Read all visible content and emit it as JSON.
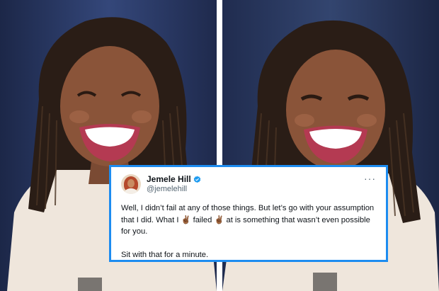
{
  "tweet": {
    "display_name": "Jemele Hill",
    "handle": "@jemelehill",
    "verified_icon": "verified-badge-icon",
    "more_icon": "more-options-icon",
    "text_line_1": "Well, I didn’t fail at any of those things. But let’s go with your assumption that I did. What I ✌🏾 failed ✌🏾 at is something that wasn’t even possible for you.",
    "text_line_2": "Sit with that for a minute."
  },
  "colors": {
    "tweet_border": "#1d8cf0",
    "verified": "#1d9bf0",
    "background_left": "#2b3a63",
    "background_right": "#2a3759"
  }
}
